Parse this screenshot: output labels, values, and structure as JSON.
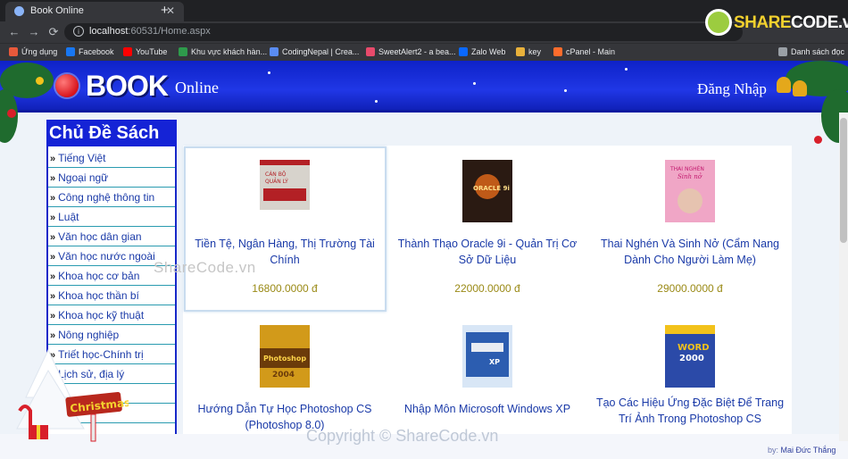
{
  "browser": {
    "tab_title": "Book Online",
    "tab_close": "✕",
    "new_tab": "+",
    "url_host": "localhost",
    "url_rest": ":60531/Home.aspx",
    "back": "←",
    "forward": "→",
    "reload": "⟳",
    "bookmarks": [
      {
        "label": "Ứng dụng",
        "color": "#e8593b"
      },
      {
        "label": "Facebook",
        "color": "#1877f2"
      },
      {
        "label": "YouTube",
        "color": "#ff0000"
      },
      {
        "label": "Khu vực khách hàn...",
        "color": "#2e9a4b"
      },
      {
        "label": "CodingNepal | Crea...",
        "color": "#5a8cf2"
      },
      {
        "label": "SweetAlert2 - a bea...",
        "color": "#e84a6b"
      },
      {
        "label": "Zalo Web",
        "color": "#0a68ff"
      },
      {
        "label": "key",
        "color": "#e8b13b"
      },
      {
        "label": "cPanel - Main",
        "color": "#ff6c2c"
      }
    ],
    "reading_list": "Danh sách đọc"
  },
  "sharecode_logo": {
    "share": "SHARE",
    "code": "CODE.vn"
  },
  "site": {
    "logo_main": "BOOK",
    "logo_sub": "Online",
    "login": "Đăng Nhập"
  },
  "sidebar": {
    "title": "Chủ Đề Sách",
    "bullet": "»",
    "items": [
      "Tiếng Việt",
      "Ngoại ngữ",
      "Công nghệ thông tin",
      "Luật",
      "Văn học dân gian",
      "Văn học nước ngoài",
      "Khoa học cơ bản",
      "Khoa học thần bí",
      "Khoa học kỹ thuật",
      "Nông nghiệp",
      "Triết học-Chính trị",
      "Lịch sử, địa lý",
      "",
      ""
    ]
  },
  "books": [
    {
      "title": "Tiền Tệ, Ngân Hàng, Thị Trường Tài Chính",
      "price": "16800.0000 đ",
      "cover_color": "#d7d3cc",
      "cover_accent": "#b32025"
    },
    {
      "title": "Thành Thạo Oracle 9i - Quản Trị Cơ Sở Dữ Liệu",
      "price": "22000.0000 đ",
      "cover_color": "#2a1a12",
      "cover_accent": "#e56a1a"
    },
    {
      "title": "Thai Nghén Và Sinh Nở (Cẩm Nang Dành Cho Người Làm Mẹ)",
      "price": "29000.0000 đ",
      "cover_color": "#f0a6c6",
      "cover_accent": "#c2186e"
    },
    {
      "title": "Hướng Dẫn Tự Học Photoshop CS (Photoshop 8.0)",
      "price": "",
      "cover_color": "#d29a1a",
      "cover_accent": "#6b3b0a"
    },
    {
      "title": "Nhập Môn Microsoft Windows XP",
      "price": "",
      "cover_color": "#2c5db0",
      "cover_accent": "#d8e6f6"
    },
    {
      "title": "Tạo Các Hiệu Ứng Đặc Biệt Để Trang Trí Ảnh Trong Photoshop CS",
      "price": "",
      "cover_color": "#2b4aa8",
      "cover_accent": "#f2c21b"
    }
  ],
  "watermarks": {
    "top": "ShareCode.vn",
    "bottom": "Copyright © ShareCode.vn"
  },
  "credit": {
    "prefix": "by:",
    "name": "Mai Đức Thắng"
  },
  "christmas_sign": "Christmas"
}
